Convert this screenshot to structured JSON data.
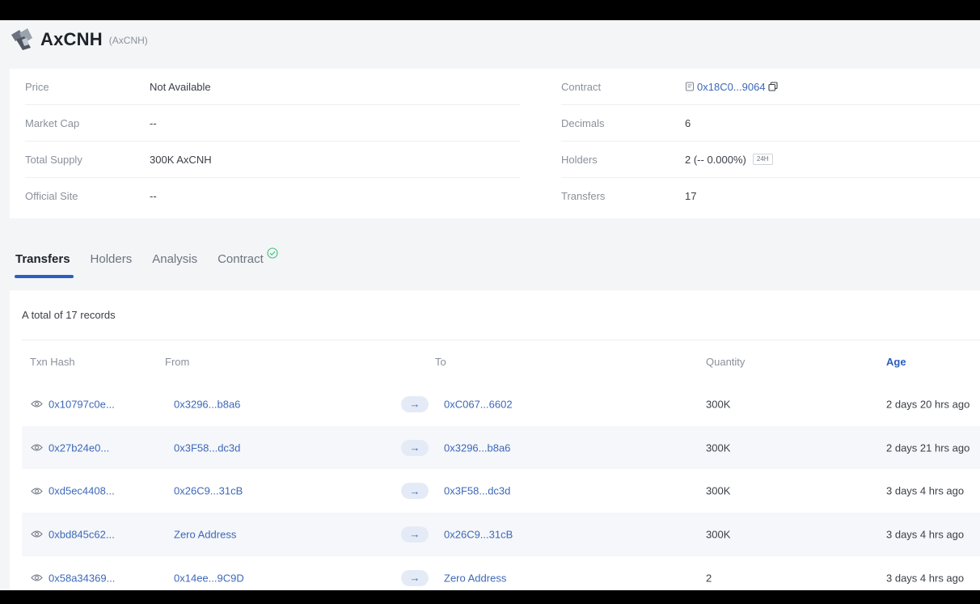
{
  "token": {
    "name": "AxCNH",
    "symbol": "(AxCNH)",
    "logo_icon": "token-logo-icon"
  },
  "overview": {
    "left": [
      {
        "label": "Price",
        "value": "Not Available"
      },
      {
        "label": "Market Cap",
        "value": "--"
      },
      {
        "label": "Total Supply",
        "value": "300K AxCNH"
      },
      {
        "label": "Official Site",
        "value": "--"
      }
    ],
    "right": {
      "contract_label": "Contract",
      "contract_value": "0x18C0...9064",
      "decimals_label": "Decimals",
      "decimals_value": "6",
      "holders_label": "Holders",
      "holders_value": "2 (-- 0.000%)",
      "holders_badge": "24H",
      "transfers_label": "Transfers",
      "transfers_value": "17"
    }
  },
  "tabs": [
    {
      "label": "Transfers",
      "active": true
    },
    {
      "label": "Holders",
      "active": false
    },
    {
      "label": "Analysis",
      "active": false
    },
    {
      "label": "Contract",
      "active": false,
      "verified_icon": "check-circle-icon"
    }
  ],
  "transfers": {
    "total_text": "A total of 17 records",
    "columns": {
      "hash": "Txn Hash",
      "from": "From",
      "to": "To",
      "quantity": "Quantity",
      "age": "Age"
    },
    "rows": [
      {
        "hash": "0x10797c0e...",
        "from": "0x3296...b8a6",
        "to": "0xC067...6602",
        "quantity": "300K",
        "age": "2 days 20 hrs ago"
      },
      {
        "hash": "0x27b24e0...",
        "from": "0x3F58...dc3d",
        "to": "0x3296...b8a6",
        "quantity": "300K",
        "age": "2 days 21 hrs ago"
      },
      {
        "hash": "0xd5ec4408...",
        "from": "0x26C9...31cB",
        "to": "0x3F58...dc3d",
        "quantity": "300K",
        "age": "3 days 4 hrs ago"
      },
      {
        "hash": "0xbd845c62...",
        "from": "Zero Address",
        "to": "0x26C9...31cB",
        "quantity": "300K",
        "age": "3 days 4 hrs ago"
      },
      {
        "hash": "0x58a34369...",
        "from": "0x14ee...9C9D",
        "to": "Zero Address",
        "quantity": "2",
        "age": "3 days 4 hrs ago"
      }
    ]
  },
  "colors": {
    "accent": "#2c5fbd",
    "link": "#3d68b8",
    "background": "#f3f5f7"
  }
}
